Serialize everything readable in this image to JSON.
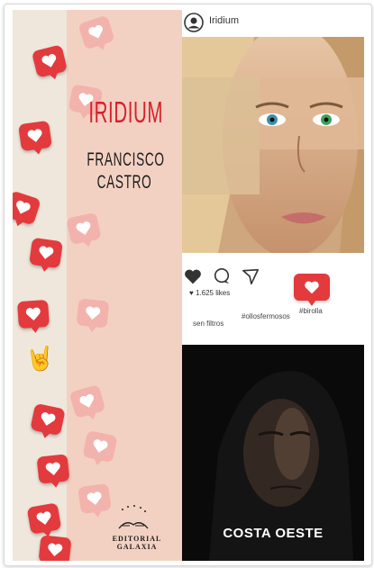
{
  "book": {
    "title": "IRIDIUM",
    "author_line1": "FRANCISCO",
    "author_line2": "CASTRO",
    "publisher": "EDITORIAL GALAXIA",
    "series": "COSTA OESTE"
  },
  "post": {
    "username": "Iridium",
    "likes": "1.625 likes",
    "tags": [
      "sen filtros",
      "#ollosfermosos",
      "#birolla"
    ]
  },
  "icons": [
    "user-icon",
    "heart-icon",
    "comment-icon",
    "send-icon",
    "rock-hand-icon"
  ],
  "colors": {
    "title_red": "#d81f2a",
    "badge_red": "#e33a3e",
    "panel_pink": "#f3d1c2"
  }
}
